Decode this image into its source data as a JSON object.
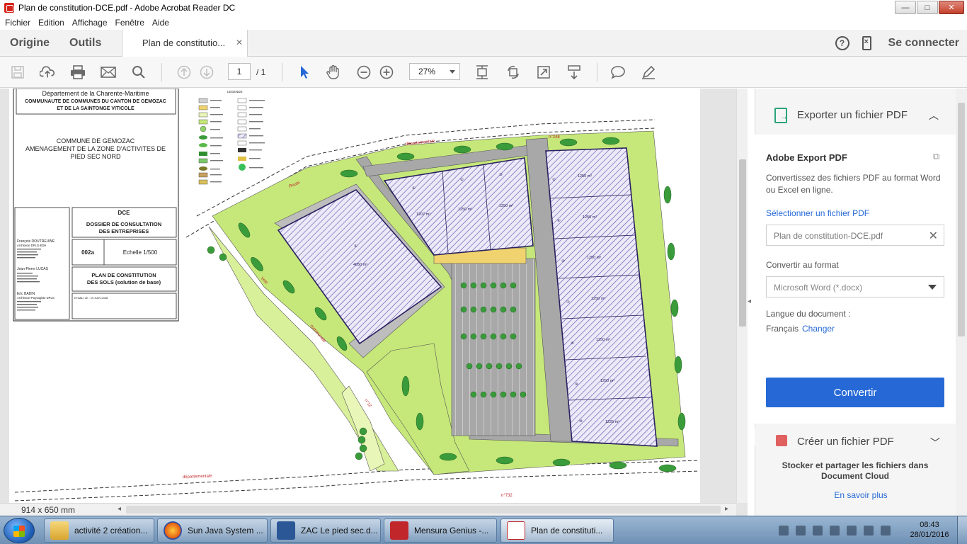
{
  "window": {
    "title": "Plan de constitution-DCE.pdf - Adobe Acrobat Reader DC",
    "min_label": "—",
    "max_label": "□",
    "close_label": "✕"
  },
  "menu": [
    "Fichier",
    "Edition",
    "Affichage",
    "Fenêtre",
    "Aide"
  ],
  "tabs": {
    "home": "Origine",
    "tools": "Outils",
    "document": "Plan de constitutio...",
    "close": "✕",
    "sign_in": "Se connecter",
    "help": "?"
  },
  "toolbar": {
    "page_current": "1",
    "page_total": "/ 1",
    "zoom": "27%"
  },
  "statusbar": {
    "page_size": "914 x 650 mm"
  },
  "plan": {
    "dept": "Département de la Charente-Maritime",
    "community_1": "COMMUNAUTE DE COMMUNES DU CANTON DE GEMOZAC",
    "community_2": "ET DE LA SAINTONGE VITICOLE",
    "commune": "COMMUNE DE GEMOZAC",
    "project_1": "AMENAGEMENT DE LA ZONE D'ACTIVITES DE",
    "project_2": "PIED SEC NORD",
    "dce": "DCE",
    "dossier_1": "DOSSIER DE CONSULTATION",
    "dossier_2": "DES ENTREPRISES",
    "plan_no": "002a",
    "scale": "Echelle 1/500",
    "plan_title_1": "PLAN DE CONSTITUTION",
    "plan_title_2": "DES SOLS (solution de base)",
    "architect_1": "François DOUTREUWE",
    "architect_1_role": "Architecte DPLG-EDH",
    "architect_2": "Jean-Pierre LUCAS",
    "architect_3": "Eric BADIN",
    "architect_3_role": "Architecte-Paysagiste DPLG",
    "date": "ETABLI LE : 19 JUIN 2008",
    "legend": "LEGENDE",
    "road_1": "Route",
    "road_2": "départementale",
    "road_3": "n°248",
    "road_4": "n°732",
    "road_5": "Voie",
    "road_6": "communale",
    "road_7": "n°12",
    "lots": [
      {
        "no": "①",
        "area": "4050 m²"
      },
      {
        "no": "①",
        "area": "1207 m²"
      },
      {
        "no": "②",
        "area": "1250 m²"
      },
      {
        "no": "③",
        "area": "1250 m²"
      },
      {
        "no": "②",
        "area": "1250 m²"
      },
      {
        "no": "④",
        "area": "1250 m²"
      },
      {
        "no": "⑤",
        "area": "1250 m²"
      },
      {
        "no": "⑦",
        "area": "1250 m²"
      },
      {
        "no": "⑧",
        "area": "1250 m²"
      },
      {
        "no": "⑨",
        "area": "1250 m²"
      },
      {
        "no": "⑩",
        "area": "1225 m²"
      }
    ]
  },
  "panel": {
    "export_header": "Exporter un fichier PDF",
    "product": "Adobe Export PDF",
    "description": "Convertissez des fichiers PDF au format Word ou Excel en ligne.",
    "select_link": "Sélectionner un fichier PDF",
    "file_name": "Plan de constitution-DCE.pdf",
    "convert_to_label": "Convertir au format",
    "format": "Microsoft Word (*.docx)",
    "language_label": "Langue du document :",
    "language": "Français",
    "change_link": "Changer",
    "convert_button": "Convertir",
    "create_header": "Créer un fichier PDF",
    "store_text_1": "Stocker et partager les fichiers dans",
    "store_text_2": "Document Cloud",
    "learn_more": "En savoir plus"
  },
  "taskbar": {
    "items": [
      "activité 2 création...",
      "Sun Java System ...",
      "ZAC Le pied sec.d...",
      "Mensura Genius -...",
      "Plan de constituti..."
    ],
    "time": "08:43",
    "date": "28/01/2016"
  },
  "colors": {
    "accent": "#2669d6",
    "lot_hatch": "#5b4aa8",
    "green_space": "#c6e87a",
    "tree": "#3a9b3a",
    "road": "#9a9a9a"
  }
}
